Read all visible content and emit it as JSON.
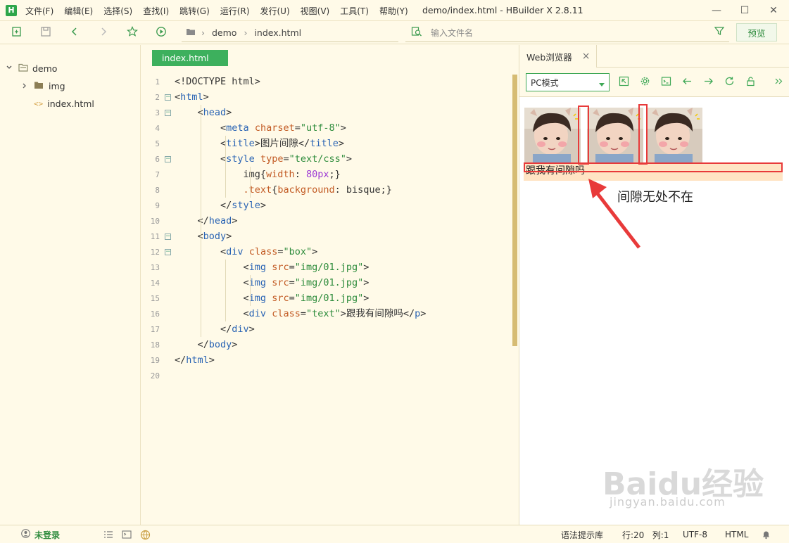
{
  "window": {
    "app_logo": "H",
    "title": "demo/index.html - HBuilder X 2.8.11",
    "min_glyph": "—",
    "max_glyph": "☐",
    "close_glyph": "✕"
  },
  "menu": [
    "文件(F)",
    "编辑(E)",
    "选择(S)",
    "查找(I)",
    "跳转(G)",
    "运行(R)",
    "发行(U)",
    "视图(V)",
    "工具(T)",
    "帮助(Y)"
  ],
  "toolbar": {
    "breadcrumb": [
      "demo",
      "index.html"
    ],
    "breadcrumb_separator": "›",
    "search_placeholder": "输入文件名",
    "preview_label": "预览"
  },
  "sidebar": {
    "project": "demo",
    "items": [
      {
        "label": "img",
        "type": "folder"
      },
      {
        "label": "index.html",
        "type": "file"
      }
    ]
  },
  "editor": {
    "tab_label": "index.html",
    "lines": [
      {
        "n": "1",
        "html": "&lt;!DOCTYPE html&gt;"
      },
      {
        "n": "2",
        "html": "&lt;<span class='t-tag'>html</span>&gt;"
      },
      {
        "n": "3",
        "html": "    &lt;<span class='t-tag'>head</span>&gt;"
      },
      {
        "n": "4",
        "html": "        &lt;<span class='t-tag'>meta</span> <span class='t-attr'>charset</span>=<span class='t-str'>\"utf-8\"</span>&gt;"
      },
      {
        "n": "5",
        "html": "        &lt;<span class='t-tag'>title</span>&gt;图片间隙&lt;/<span class='t-tag'>title</span>&gt;"
      },
      {
        "n": "6",
        "html": "        &lt;<span class='t-tag'>style</span> <span class='t-attr'>type</span>=<span class='t-str'>\"text/css\"</span>&gt;"
      },
      {
        "n": "7",
        "html": "            img{<span class='t-attr'>width</span>: <span class='t-num'>80px</span>;}"
      },
      {
        "n": "8",
        "html": "            <span class='t-attr'>.text</span>{<span class='t-attr'>background</span>: bisque;}"
      },
      {
        "n": "9",
        "html": "        &lt;/<span class='t-tag'>style</span>&gt;"
      },
      {
        "n": "10",
        "html": "    &lt;/<span class='t-tag'>head</span>&gt;"
      },
      {
        "n": "11",
        "html": "    &lt;<span class='t-tag'>body</span>&gt;"
      },
      {
        "n": "12",
        "html": "        &lt;<span class='t-tag'>div</span> <span class='t-attr'>class</span>=<span class='t-str'>\"box\"</span>&gt;"
      },
      {
        "n": "13",
        "html": "            &lt;<span class='t-tag'>img</span> <span class='t-attr'>src</span>=<span class='t-str'>\"img/01.jpg\"</span>&gt;"
      },
      {
        "n": "14",
        "html": "            &lt;<span class='t-tag'>img</span> <span class='t-attr'>src</span>=<span class='t-str'>\"img/01.jpg\"</span>&gt;"
      },
      {
        "n": "15",
        "html": "            &lt;<span class='t-tag'>img</span> <span class='t-attr'>src</span>=<span class='t-str'>\"img/01.jpg\"</span>&gt;"
      },
      {
        "n": "16",
        "html": "            &lt;<span class='t-tag'>div</span> <span class='t-attr'>class</span>=<span class='t-str'>\"text\"</span>&gt;跟我有间隙吗&lt;/<span class='t-tag'>p</span>&gt;"
      },
      {
        "n": "17",
        "html": "        &lt;/<span class='t-tag'>div</span>&gt;"
      },
      {
        "n": "18",
        "html": "    &lt;/<span class='t-tag'>body</span>&gt;"
      },
      {
        "n": "19",
        "html": "&lt;/<span class='t-tag'>html</span>&gt;"
      },
      {
        "n": "20",
        "html": ""
      }
    ]
  },
  "browser": {
    "tab_label": "Web浏览器",
    "tab_close": "×",
    "mode": "PC模式",
    "preview_text": "跟我有间隙吗",
    "annotation": "间隙无处不在"
  },
  "watermark": {
    "brand": "Baidu经验",
    "url": "jingyan.baidu.com"
  },
  "statusbar": {
    "login": "未登录",
    "syntax_lib": "语法提示库",
    "position": "行:20   列:1",
    "encoding": "UTF-8",
    "language": "HTML"
  },
  "colors": {
    "accent": "#3db05d",
    "background": "#fffae8",
    "highlight_red": "#e83a3a",
    "bisque": "#ffe4c4"
  }
}
